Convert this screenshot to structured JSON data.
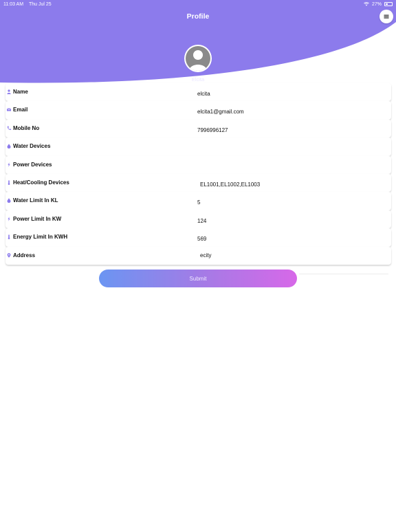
{
  "status_bar": {
    "time": "11:03 AM",
    "date": "Thu Jul 25",
    "battery": "27%"
  },
  "header": {
    "title": "Profile",
    "menu_icon": "menu-icon",
    "color": "#8c7bec"
  },
  "profile": {
    "name": "Elcita",
    "avatar_icon": "person-icon"
  },
  "fields": [
    {
      "label": "Name",
      "icon": "person-icon",
      "value": "elcita"
    },
    {
      "label": "Email",
      "icon": "mail-icon",
      "value": "elcita1@gmail.com"
    },
    {
      "label": "Mobile No",
      "icon": "phone-icon",
      "value": "7996996127"
    },
    {
      "label": "Water Devices",
      "icon": "drop-icon",
      "value": ""
    },
    {
      "label": "Power Devices",
      "icon": "bolt-icon",
      "value": ""
    },
    {
      "label": "Heat/Cooling Devices",
      "icon": "thermometer-icon",
      "value": "EL1001,EL1002,EL1003"
    },
    {
      "label": "Water Limit In KL",
      "icon": "drop-icon",
      "value": "5"
    },
    {
      "label": "Power Limit In KW",
      "icon": "bolt-icon",
      "value": "124"
    },
    {
      "label": "Energy Limit In KWH",
      "icon": "thermometer-icon",
      "value": "569"
    },
    {
      "label": "Address",
      "icon": "location-icon",
      "value": "ecity"
    }
  ],
  "submit": {
    "label": "Submit"
  }
}
